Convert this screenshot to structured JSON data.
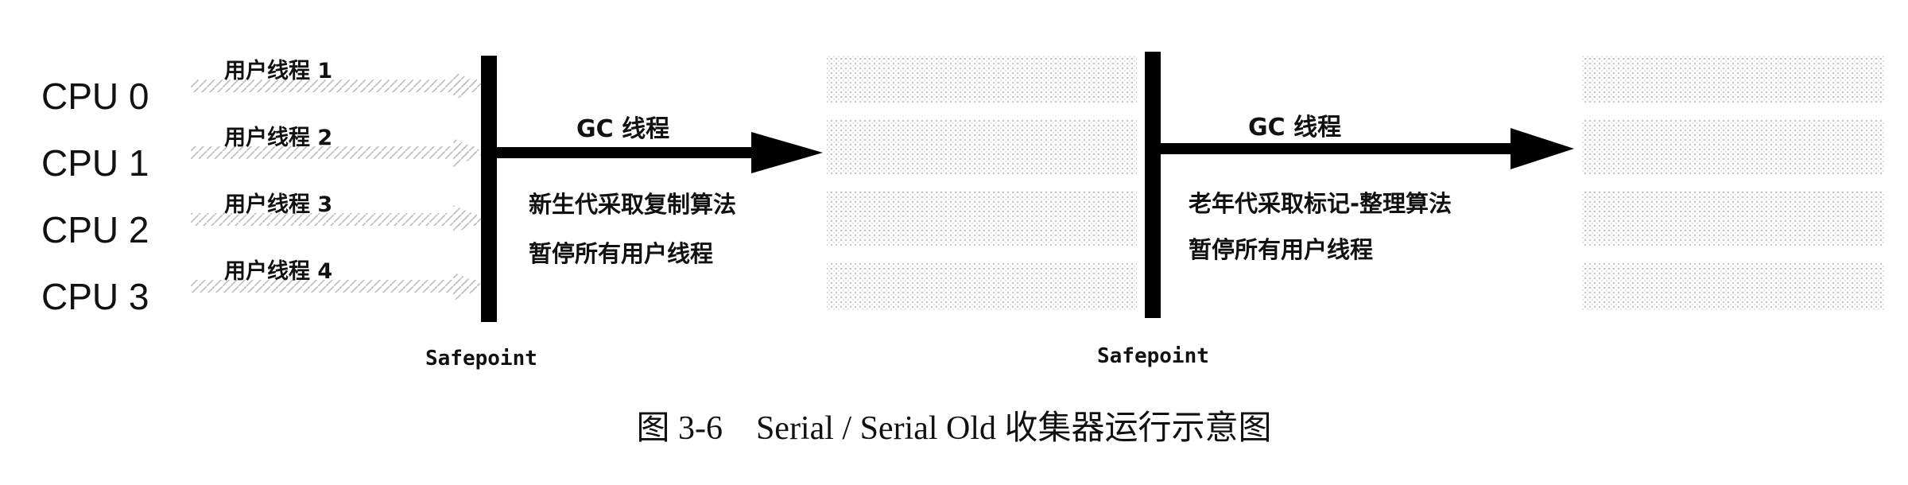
{
  "cpus": [
    "CPU 0",
    "CPU 1",
    "CPU 2",
    "CPU 3"
  ],
  "threads": [
    "用户线程 1",
    "用户线程 2",
    "用户线程 3",
    "用户线程 4"
  ],
  "phase1": {
    "gc_label": "GC 线程",
    "desc_line1": "新生代采取复制算法",
    "desc_line2": "暂停所有用户线程",
    "safepoint": "Safepoint"
  },
  "phase2": {
    "gc_label": "GC 线程",
    "desc_line1": "老年代采取标记-整理算法",
    "desc_line2": "暂停所有用户线程",
    "safepoint": "Safepoint"
  },
  "caption": "图 3-6　Serial / Serial Old 收集器运行示意图"
}
